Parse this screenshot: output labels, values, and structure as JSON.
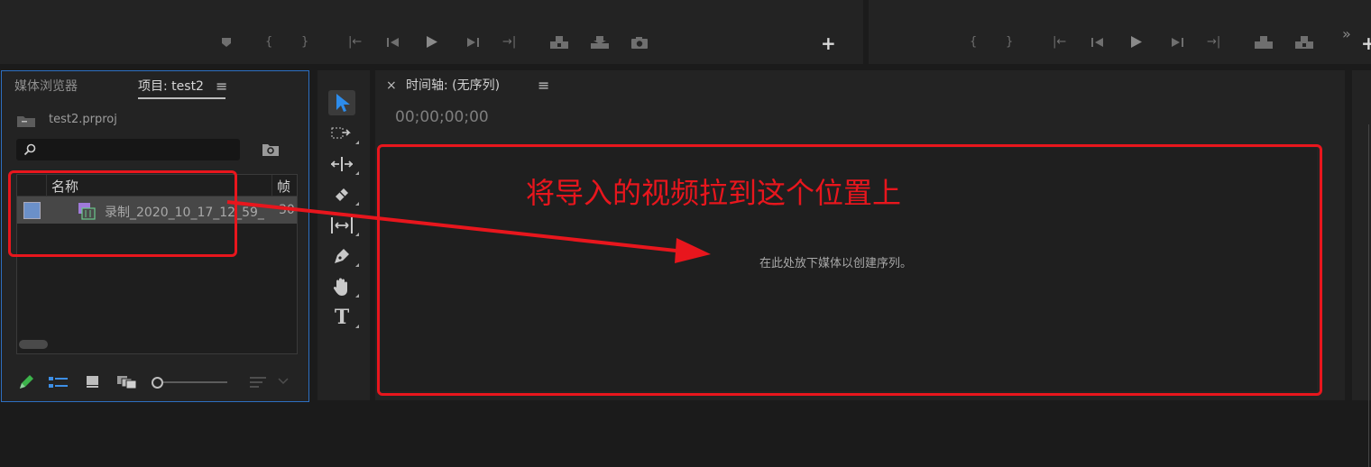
{
  "top_bar": {
    "left_plus": "+",
    "right_more": "»",
    "right_plus": "+"
  },
  "project_panel": {
    "tab_media_browser": "媒体浏览器",
    "tab_project": "项目: test2",
    "menu_icon": "≡",
    "project_file": "test2.prproj",
    "search_placeholder": "",
    "columns": {
      "name": "名称",
      "frame_rate": "帧"
    },
    "items": [
      {
        "name": "录制_2020_10_17_12_59_",
        "frame_rate": "30"
      }
    ]
  },
  "timeline_panel": {
    "close": "×",
    "title": "时间轴: (无序列)",
    "menu_icon": "≡",
    "timecode": "00;00;00;00",
    "drop_hint": "在此处放下媒体以创建序列。"
  },
  "annotation": {
    "text": "将导入的视频拉到这个位置上",
    "color": "#e8161d"
  },
  "tools": [
    "selection-tool",
    "track-select-forward-tool",
    "ripple-edit-tool",
    "razor-tool",
    "slip-tool",
    "pen-tool",
    "hand-tool",
    "type-tool"
  ],
  "tool_glyphs": {
    "type": "T"
  },
  "colors": {
    "accent": "#2d8ceb",
    "bg": "#1b1b1b",
    "panel": "#232323",
    "red": "#e8161d"
  }
}
